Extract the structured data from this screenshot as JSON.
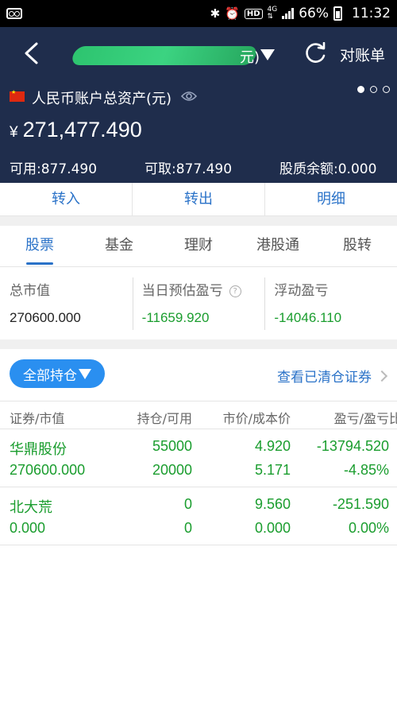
{
  "status_bar": {
    "battery": "66%",
    "time": "11:32",
    "network": "4G",
    "hd": "HD"
  },
  "header": {
    "account_suffix": "元)",
    "reconcile_label": "对账单",
    "assets_label": "人民币账户总资产(元)",
    "currency_symbol": "¥",
    "total_assets": "271,477.490",
    "available": "可用:877.490",
    "withdrawable": "可取:877.490",
    "pledge_balance": "股质余额:0.000"
  },
  "actions": {
    "transfer_in": "转入",
    "transfer_out": "转出",
    "details": "明细"
  },
  "tabs": [
    {
      "label": "股票",
      "active": true
    },
    {
      "label": "基金",
      "active": false
    },
    {
      "label": "理财",
      "active": false
    },
    {
      "label": "港股通",
      "active": false
    },
    {
      "label": "股转",
      "active": false
    }
  ],
  "summary": {
    "market_value_label": "总市值",
    "market_value": "270600.000",
    "daily_pl_label": "当日预估盈亏",
    "daily_pl": "-11659.920",
    "floating_pl_label": "浮动盈亏",
    "floating_pl": "-14046.110"
  },
  "positions": {
    "filter_label": "全部持仓",
    "cleared_link": "查看已清仓证券",
    "columns": [
      "证券/市值",
      "持仓/可用",
      "市价/成本价",
      "盈亏/盈亏比"
    ],
    "rows": [
      {
        "name": "华鼎股份",
        "value": "270600.000",
        "holding": "55000",
        "available": "20000",
        "price": "4.920",
        "cost": "5.171",
        "pl": "-13794.520",
        "pl_pct": "-4.85%"
      },
      {
        "name": "北大荒",
        "value": "0.000",
        "holding": "0",
        "available": "0",
        "price": "9.560",
        "cost": "0.000",
        "pl": "-251.590",
        "pl_pct": "0.00%"
      }
    ]
  },
  "colors": {
    "header_bg": "#1f2d4c",
    "accent": "#2a72c8",
    "button": "#2a8ff0",
    "loss": "#1a9d2e"
  }
}
